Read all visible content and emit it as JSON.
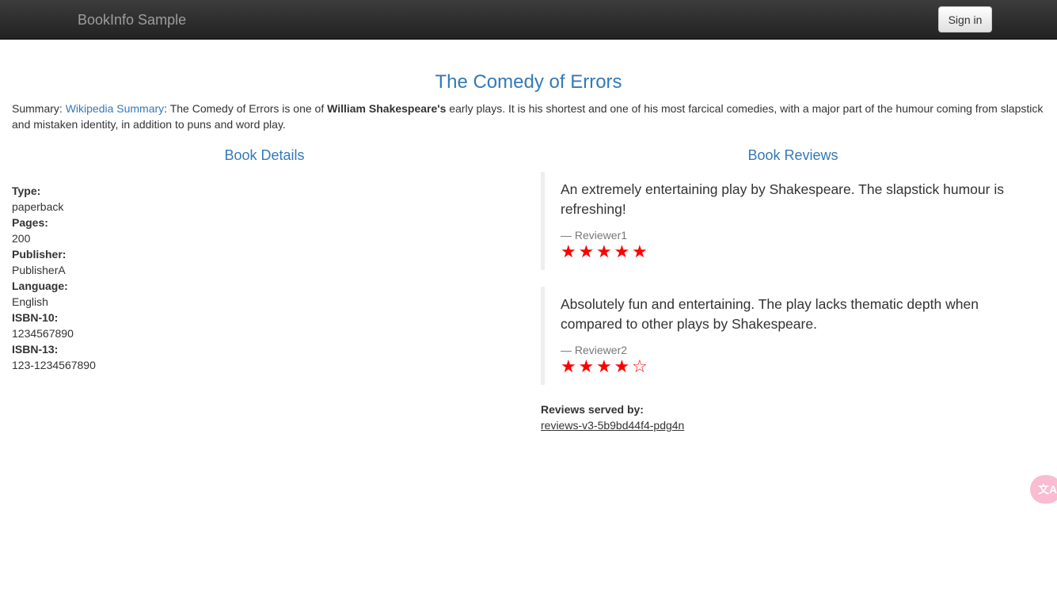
{
  "navbar": {
    "brand": "BookInfo Sample",
    "signin_label": "Sign in"
  },
  "book": {
    "title": "The Comedy of Errors",
    "summary_prefix": "Summary: ",
    "summary_link": "Wikipedia Summary",
    "summary_part1": ": The Comedy of Errors is one of ",
    "summary_bold": "William Shakespeare's",
    "summary_part2": " early plays. It is his shortest and one of his most farcical comedies, with a major part of the humour coming from slapstick and mistaken identity, in addition to puns and word play."
  },
  "details": {
    "heading": "Book Details",
    "fields": [
      {
        "label": "Type:",
        "value": "paperback"
      },
      {
        "label": "Pages:",
        "value": "200"
      },
      {
        "label": "Publisher:",
        "value": "PublisherA"
      },
      {
        "label": "Language:",
        "value": "English"
      },
      {
        "label": "ISBN-10:",
        "value": "1234567890"
      },
      {
        "label": "ISBN-13:",
        "value": "123-1234567890"
      }
    ]
  },
  "reviews": {
    "heading": "Book Reviews",
    "items": [
      {
        "text": "An extremely entertaining play by Shakespeare. The slapstick humour is refreshing!",
        "reviewer": "— Reviewer1",
        "rating": 5
      },
      {
        "text": "Absolutely fun and entertaining. The play lacks thematic depth when compared to other plays by Shakespeare.",
        "reviewer": "— Reviewer2",
        "rating": 4
      }
    ],
    "served_label": "Reviews served by:",
    "served_pod": "reviews-v3-5b9bd44f4-pdg4n",
    "star_color": "#ff0000"
  },
  "overlay": {
    "translate_icon": "translate-icon",
    "translate_glyph": "文A",
    "color": "#f9bcd0"
  }
}
